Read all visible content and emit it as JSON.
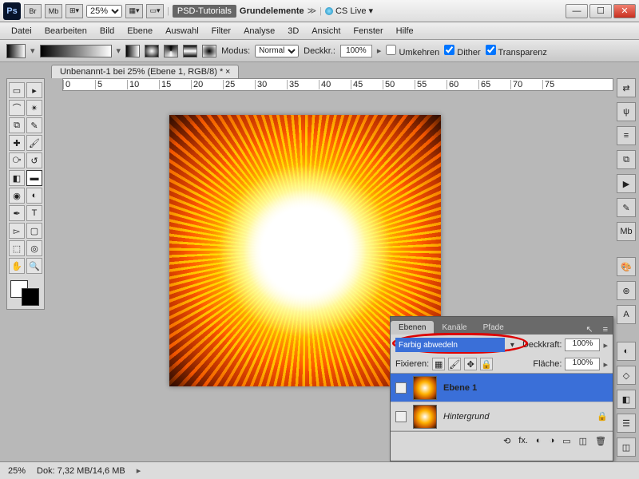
{
  "titlebar": {
    "zoom_options": "25%",
    "breadcrumb1": "PSD-Tutorials",
    "breadcrumb2": "Grundelemente",
    "cslive": "CS Live"
  },
  "menu": [
    "Datei",
    "Bearbeiten",
    "Bild",
    "Ebene",
    "Auswahl",
    "Filter",
    "Analyse",
    "3D",
    "Ansicht",
    "Fenster",
    "Hilfe"
  ],
  "opt": {
    "modus_label": "Modus:",
    "modus_value": "Normal",
    "deck_label": "Deckkr.:",
    "deck_value": "100%",
    "umkehren": "Umkehren",
    "dither": "Dither",
    "transparenz": "Transparenz"
  },
  "doc_tab": "Unbenannt-1 bei 25% (Ebene 1, RGB/8) *",
  "ruler_ticks": [
    "0",
    "5",
    "10",
    "15",
    "20",
    "25",
    "30",
    "35",
    "40",
    "45",
    "50",
    "55",
    "60",
    "65",
    "70",
    "75"
  ],
  "panels": {
    "tabs": {
      "ebenen": "Ebenen",
      "kanale": "Kanäle",
      "pfade": "Pfade"
    },
    "blend_value": "Farbig abwedeln",
    "deck_label": "Deckkraft:",
    "deck_value": "100%",
    "fix_label": "Fixieren:",
    "flache_label": "Fläche:",
    "flache_value": "100%",
    "layer1": "Ebene 1",
    "layer_bg": "Hintergrund",
    "bottom_icons": [
      "⟲",
      "fx.",
      "◐",
      "◑",
      "▭",
      "◫",
      "🗑"
    ]
  },
  "status": {
    "zoom": "25%",
    "doc": "Dok: 7,32 MB/14,6 MB"
  },
  "right_icons": [
    "⇄",
    "ψ",
    "≡",
    "⧉",
    "▶",
    "✎",
    "Mb",
    "⋯",
    "🎨",
    "⊛",
    "A"
  ],
  "right_icons2": [
    "◐",
    "◇",
    "◧",
    "☰",
    "◫"
  ]
}
